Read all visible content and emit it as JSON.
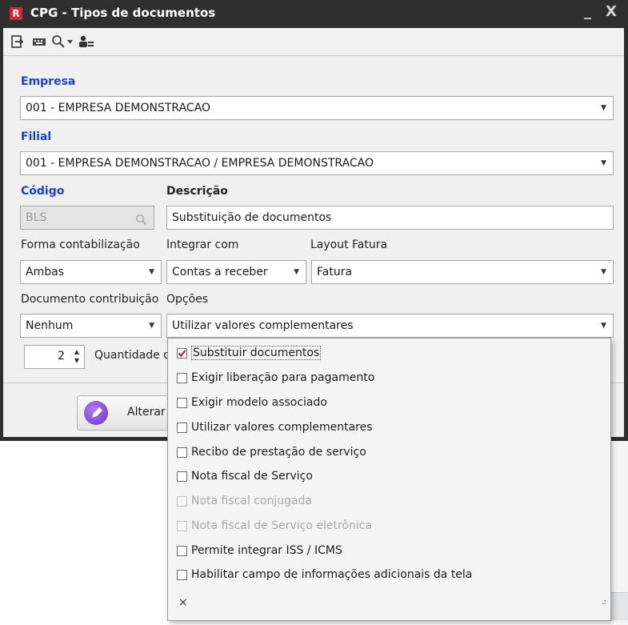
{
  "window": {
    "title": "CPG - Tipos de documentos",
    "app_icon": "R",
    "minimize": "_",
    "close": "X"
  },
  "toolbar": {
    "icons": [
      "exit-icon",
      "keyboard-icon",
      "search-icon",
      "dropdown-caret-icon",
      "users-icon"
    ]
  },
  "form": {
    "empresa_label": "Empresa",
    "empresa_value": "001 - EMPRESA DEMONSTRACAO",
    "filial_label": "Filial",
    "filial_value": "001 - EMPRESA DEMONSTRACAO / EMPRESA DEMONSTRACAO",
    "codigo_label": "Código",
    "codigo_value": "BLS",
    "descricao_label": "Descrição",
    "descricao_value": "Substituição de documentos",
    "forma_label": "Forma contabilização",
    "forma_value": "Ambas",
    "integrar_label": "Integrar com",
    "integrar_value": "Contas a receber",
    "layout_label": "Layout Fatura",
    "layout_value": "Fatura",
    "documento_label": "Documento contribuição",
    "documento_value": "Nenhum",
    "opcoes_label": "Opções",
    "opcoes_value": "Utilizar valores complementares",
    "quantidade_value": "2",
    "quantidade_label": "Quantidade de",
    "alterar_label": "Alterar"
  },
  "options": {
    "items": [
      {
        "label": "Substituir documentos",
        "checked": true,
        "enabled": true
      },
      {
        "label": "Exigir liberação para pagamento",
        "checked": false,
        "enabled": true
      },
      {
        "label": "Exigir modelo associado",
        "checked": false,
        "enabled": true
      },
      {
        "label": "Utilizar valores complementares",
        "checked": false,
        "enabled": true
      },
      {
        "label": "Recibo de prestação de serviço",
        "checked": false,
        "enabled": true
      },
      {
        "label": "Nota fiscal de Serviço",
        "checked": false,
        "enabled": true
      },
      {
        "label": "Nota fiscal conjugada",
        "checked": false,
        "enabled": false
      },
      {
        "label": "Nota fiscal de Serviço eletrônica",
        "checked": false,
        "enabled": false
      },
      {
        "label": "Permite integrar ISS / ICMS",
        "checked": false,
        "enabled": true
      },
      {
        "label": "Habilitar campo de informações adicionais da tela",
        "checked": false,
        "enabled": true
      }
    ],
    "close_symbol": "×",
    "grip_symbol": ".:"
  },
  "colors": {
    "label_blue": "#1a3fd6",
    "check_red": "#d32020",
    "titlebar": "#2f2f2f"
  }
}
